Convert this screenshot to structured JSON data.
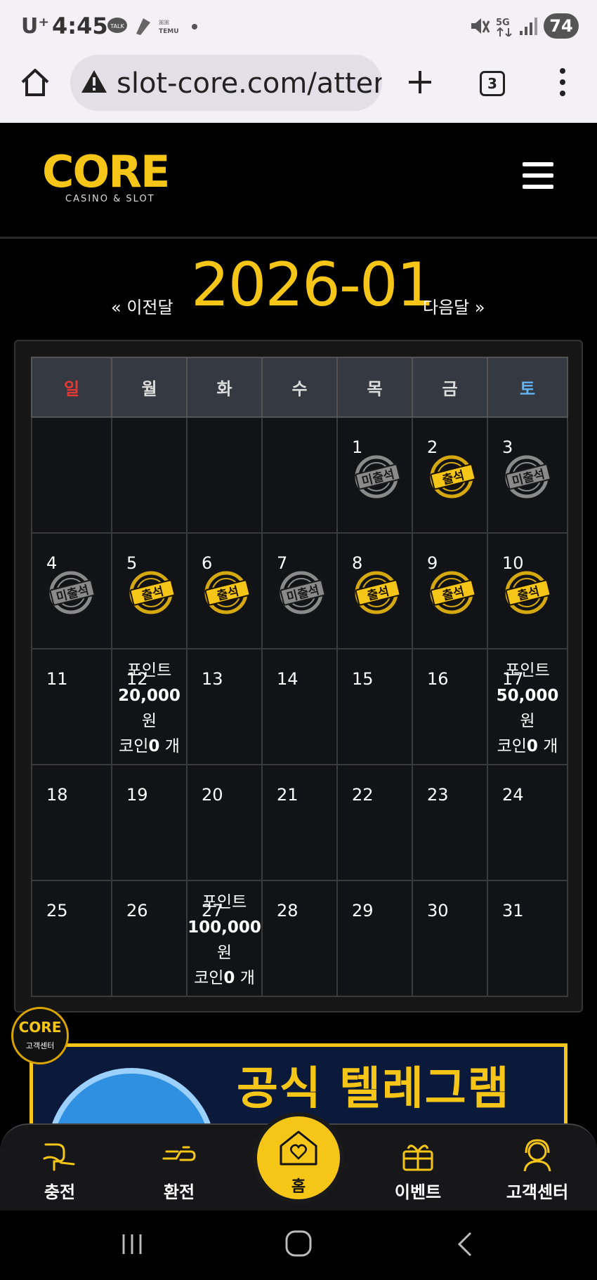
{
  "status_bar": {
    "carrier": "U⁺",
    "time": "4:45",
    "battery": "74",
    "network": "5G"
  },
  "browser": {
    "url": "slot-core.com/atter",
    "tab_count": "3"
  },
  "site": {
    "logo_text": "CORE",
    "logo_subtext": "CASINO & SLOT"
  },
  "month_nav": {
    "prev_label": "« 이전달",
    "title": "2026-01",
    "next_label": "다음달 »"
  },
  "calendar": {
    "weekdays": [
      "일",
      "월",
      "화",
      "수",
      "목",
      "금",
      "토"
    ],
    "weekday_colors": {
      "sun": "#e53935",
      "sat": "#64b5f6",
      "default": "#dddddd"
    },
    "stamp_labels": {
      "attended": "출석",
      "absent": "미출석"
    },
    "days": [
      {
        "day": "",
        "status": ""
      },
      {
        "day": "",
        "status": ""
      },
      {
        "day": "",
        "status": ""
      },
      {
        "day": "",
        "status": ""
      },
      {
        "day": "1",
        "status": "absent"
      },
      {
        "day": "2",
        "status": "attended"
      },
      {
        "day": "3",
        "status": "absent"
      },
      {
        "day": "4",
        "status": "absent"
      },
      {
        "day": "5",
        "status": "attended"
      },
      {
        "day": "6",
        "status": "attended"
      },
      {
        "day": "7",
        "status": "absent"
      },
      {
        "day": "8",
        "status": "attended"
      },
      {
        "day": "9",
        "status": "attended"
      },
      {
        "day": "10",
        "status": "attended"
      },
      {
        "day": "11",
        "status": ""
      },
      {
        "day": "12",
        "status": "",
        "reward": {
          "point_label": "포인트",
          "point_amount": "20,000",
          "point_unit": "원",
          "coin_label": "코인",
          "coin_amount": "0",
          "coin_unit": "개"
        }
      },
      {
        "day": "13",
        "status": ""
      },
      {
        "day": "14",
        "status": ""
      },
      {
        "day": "15",
        "status": ""
      },
      {
        "day": "16",
        "status": ""
      },
      {
        "day": "17",
        "status": "",
        "reward": {
          "point_label": "포인트",
          "point_amount": "50,000",
          "point_unit": "원",
          "coin_label": "코인",
          "coin_amount": "0",
          "coin_unit": "개"
        }
      },
      {
        "day": "18",
        "status": ""
      },
      {
        "day": "19",
        "status": ""
      },
      {
        "day": "20",
        "status": ""
      },
      {
        "day": "21",
        "status": ""
      },
      {
        "day": "22",
        "status": ""
      },
      {
        "day": "23",
        "status": ""
      },
      {
        "day": "24",
        "status": ""
      },
      {
        "day": "25",
        "status": ""
      },
      {
        "day": "26",
        "status": ""
      },
      {
        "day": "27",
        "status": "",
        "reward": {
          "point_label": "포인트",
          "point_amount": "100,000",
          "point_unit": "원",
          "coin_label": "코인",
          "coin_amount": "0",
          "coin_unit": "개"
        }
      },
      {
        "day": "28",
        "status": ""
      },
      {
        "day": "29",
        "status": ""
      },
      {
        "day": "30",
        "status": ""
      },
      {
        "day": "31",
        "status": ""
      }
    ]
  },
  "support_badge": {
    "logo_text": "CORE",
    "label": "고객센터"
  },
  "banner": {
    "text": "공식 텔레그램"
  },
  "bottom_nav": {
    "items": [
      {
        "label": "충전",
        "icon": "deposit-icon"
      },
      {
        "label": "환전",
        "icon": "withdraw-icon"
      },
      {
        "label": "홈",
        "icon": "home-heart-icon"
      },
      {
        "label": "이벤트",
        "icon": "gift-icon"
      },
      {
        "label": "고객센터",
        "icon": "support-agent-icon"
      }
    ]
  },
  "colors": {
    "accent": "#f5c518",
    "background": "#000000",
    "cell": "#121317",
    "header_cell": "#353941"
  }
}
